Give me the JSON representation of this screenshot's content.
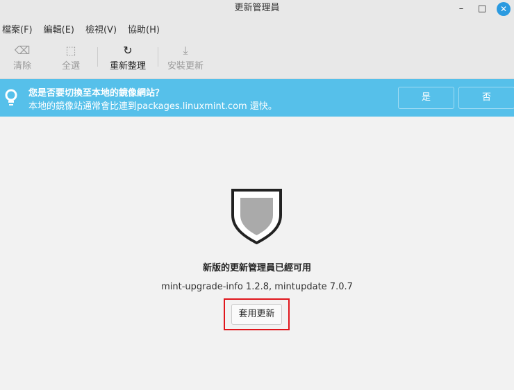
{
  "window": {
    "title": "更新管理員",
    "minimize": "–",
    "maximize": "□",
    "close": "✕"
  },
  "menu": [
    "檔案(F)",
    "編輯(E)",
    "檢視(V)",
    "協助(H)"
  ],
  "toolbar": [
    {
      "label": "清除",
      "icon": "⌫"
    },
    {
      "label": "全選",
      "icon": "⬚"
    },
    {
      "label": "重新整理",
      "icon": "↻"
    },
    {
      "label": "安裝更新",
      "icon": "⤓"
    }
  ],
  "infobar": {
    "title": "您是否要切換至本地的鏡像網站？",
    "text": "本地的鏡像站通常會比連到packages.linuxmint.com 還快。",
    "yes": "是",
    "no": "否",
    "bulb": "💡"
  },
  "main": {
    "heading": "新版的更新管理員已經可用",
    "packages": "mint-upgrade-info 1.2.8, mintupdate 7.0.7",
    "apply": "套用更新"
  }
}
